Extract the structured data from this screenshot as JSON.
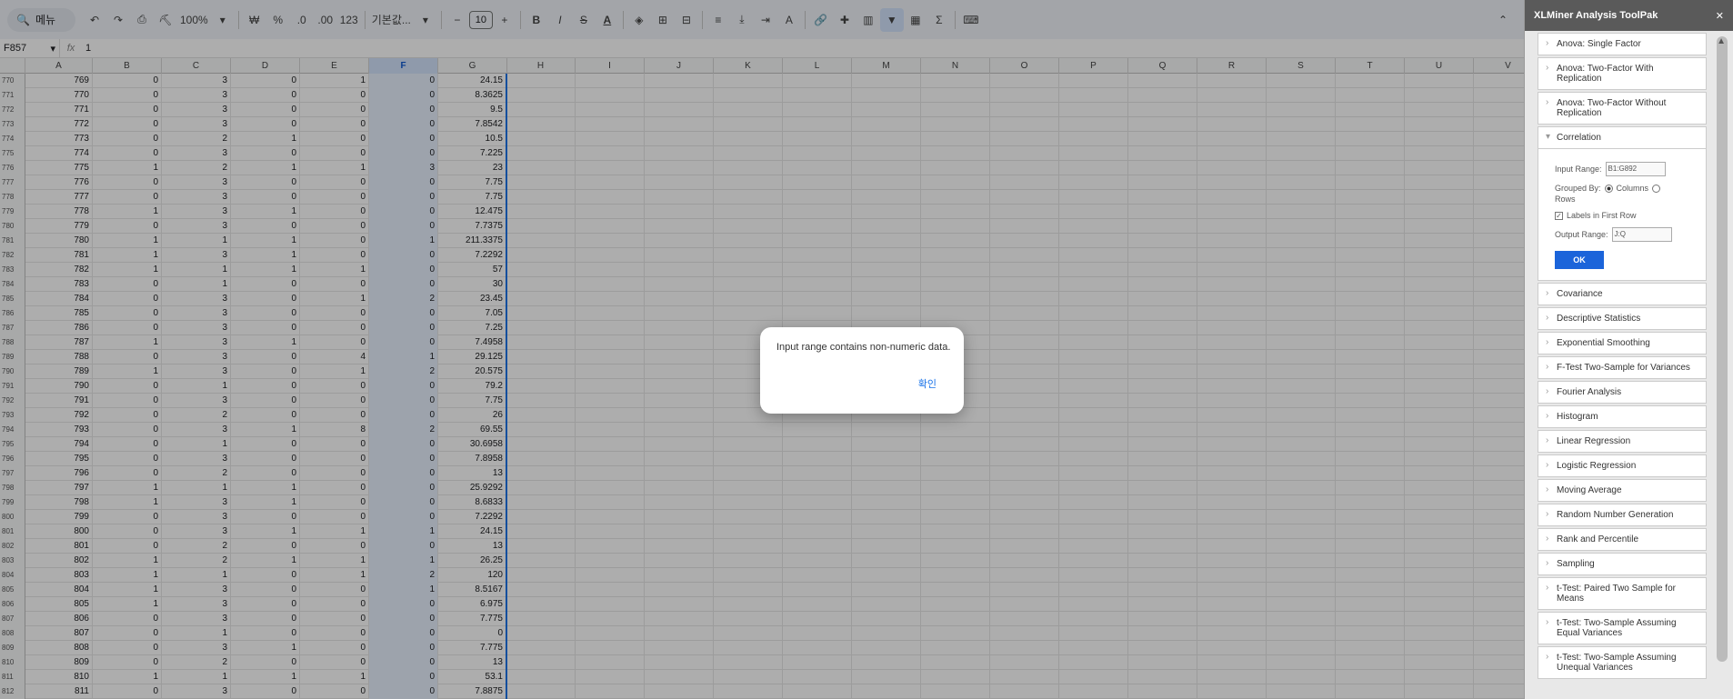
{
  "toolbar": {
    "menu_label": "메뉴",
    "zoom": "100%",
    "currency": "₩",
    "percent": "%",
    "dec_less": ".0",
    "dec_more": ".00",
    "format_123": "123",
    "font_name": "기본값...",
    "font_size": "10",
    "minus": "−",
    "plus": "+",
    "bold": "B",
    "italic": "I",
    "strike": "S",
    "text_color": "A",
    "sigma": "Σ"
  },
  "formula_bar": {
    "cell_ref": "F857",
    "fx": "fx",
    "value": "1"
  },
  "columns": [
    "A",
    "B",
    "C",
    "D",
    "E",
    "F",
    "G",
    "H",
    "I",
    "J",
    "K",
    "L",
    "M",
    "N",
    "O",
    "P",
    "Q",
    "R",
    "S",
    "T",
    "U",
    "V"
  ],
  "rows": [
    [
      "770",
      "769",
      "0",
      "3",
      "0",
      "1",
      "0",
      "24.15"
    ],
    [
      "771",
      "770",
      "0",
      "3",
      "0",
      "0",
      "0",
      "8.3625"
    ],
    [
      "772",
      "771",
      "0",
      "3",
      "0",
      "0",
      "0",
      "9.5"
    ],
    [
      "773",
      "772",
      "0",
      "3",
      "0",
      "0",
      "0",
      "7.8542"
    ],
    [
      "774",
      "773",
      "0",
      "2",
      "1",
      "0",
      "0",
      "10.5"
    ],
    [
      "775",
      "774",
      "0",
      "3",
      "0",
      "0",
      "0",
      "7.225"
    ],
    [
      "776",
      "775",
      "1",
      "2",
      "1",
      "1",
      "3",
      "23"
    ],
    [
      "777",
      "776",
      "0",
      "3",
      "0",
      "0",
      "0",
      "7.75"
    ],
    [
      "778",
      "777",
      "0",
      "3",
      "0",
      "0",
      "0",
      "7.75"
    ],
    [
      "779",
      "778",
      "1",
      "3",
      "1",
      "0",
      "0",
      "12.475"
    ],
    [
      "780",
      "779",
      "0",
      "3",
      "0",
      "0",
      "0",
      "7.7375"
    ],
    [
      "781",
      "780",
      "1",
      "1",
      "1",
      "0",
      "1",
      "211.3375"
    ],
    [
      "782",
      "781",
      "1",
      "3",
      "1",
      "0",
      "0",
      "7.2292"
    ],
    [
      "783",
      "782",
      "1",
      "1",
      "1",
      "1",
      "0",
      "57"
    ],
    [
      "784",
      "783",
      "0",
      "1",
      "0",
      "0",
      "0",
      "30"
    ],
    [
      "785",
      "784",
      "0",
      "3",
      "0",
      "1",
      "2",
      "23.45"
    ],
    [
      "786",
      "785",
      "0",
      "3",
      "0",
      "0",
      "0",
      "7.05"
    ],
    [
      "787",
      "786",
      "0",
      "3",
      "0",
      "0",
      "0",
      "7.25"
    ],
    [
      "788",
      "787",
      "1",
      "3",
      "1",
      "0",
      "0",
      "7.4958"
    ],
    [
      "789",
      "788",
      "0",
      "3",
      "0",
      "4",
      "1",
      "29.125"
    ],
    [
      "790",
      "789",
      "1",
      "3",
      "0",
      "1",
      "2",
      "20.575"
    ],
    [
      "791",
      "790",
      "0",
      "1",
      "0",
      "0",
      "0",
      "79.2"
    ],
    [
      "792",
      "791",
      "0",
      "3",
      "0",
      "0",
      "0",
      "7.75"
    ],
    [
      "793",
      "792",
      "0",
      "2",
      "0",
      "0",
      "0",
      "26"
    ],
    [
      "794",
      "793",
      "0",
      "3",
      "1",
      "8",
      "2",
      "69.55"
    ],
    [
      "795",
      "794",
      "0",
      "1",
      "0",
      "0",
      "0",
      "30.6958"
    ],
    [
      "796",
      "795",
      "0",
      "3",
      "0",
      "0",
      "0",
      "7.8958"
    ],
    [
      "797",
      "796",
      "0",
      "2",
      "0",
      "0",
      "0",
      "13"
    ],
    [
      "798",
      "797",
      "1",
      "1",
      "1",
      "0",
      "0",
      "25.9292"
    ],
    [
      "799",
      "798",
      "1",
      "3",
      "1",
      "0",
      "0",
      "8.6833"
    ],
    [
      "800",
      "799",
      "0",
      "3",
      "0",
      "0",
      "0",
      "7.2292"
    ],
    [
      "801",
      "800",
      "0",
      "3",
      "1",
      "1",
      "1",
      "24.15"
    ],
    [
      "802",
      "801",
      "0",
      "2",
      "0",
      "0",
      "0",
      "13"
    ],
    [
      "803",
      "802",
      "1",
      "2",
      "1",
      "1",
      "1",
      "26.25"
    ],
    [
      "804",
      "803",
      "1",
      "1",
      "0",
      "1",
      "2",
      "120"
    ],
    [
      "805",
      "804",
      "1",
      "3",
      "0",
      "0",
      "1",
      "8.5167"
    ],
    [
      "806",
      "805",
      "1",
      "3",
      "0",
      "0",
      "0",
      "6.975"
    ],
    [
      "807",
      "806",
      "0",
      "3",
      "0",
      "0",
      "0",
      "7.775"
    ],
    [
      "808",
      "807",
      "0",
      "1",
      "0",
      "0",
      "0",
      "0"
    ],
    [
      "809",
      "808",
      "0",
      "3",
      "1",
      "0",
      "0",
      "7.775"
    ],
    [
      "810",
      "809",
      "0",
      "2",
      "0",
      "0",
      "0",
      "13"
    ],
    [
      "811",
      "810",
      "1",
      "1",
      "1",
      "1",
      "0",
      "53.1"
    ],
    [
      "812",
      "811",
      "0",
      "3",
      "0",
      "0",
      "0",
      "7.8875"
    ]
  ],
  "dialog": {
    "message": "Input range contains non-numeric data.",
    "ok": "확인"
  },
  "panel": {
    "title": "XLMiner Analysis ToolPak",
    "close": "✕",
    "tools": [
      "Anova: Single Factor",
      "Anova: Two-Factor With Replication",
      "Anova: Two-Factor Without Replication",
      "Correlation",
      "Covariance",
      "Descriptive Statistics",
      "Exponential Smoothing",
      "F-Test Two-Sample for Variances",
      "Fourier Analysis",
      "Histogram",
      "Linear Regression",
      "Logistic Regression",
      "Moving Average",
      "Random Number Generation",
      "Rank and Percentile",
      "Sampling",
      "t-Test: Paired Two Sample for Means",
      "t-Test: Two-Sample Assuming Equal Variances",
      "t-Test: Two-Sample Assuming Unequal Variances"
    ],
    "correlation": {
      "input_label": "Input Range:",
      "input_value": "B1:G892",
      "grouped_label": "Grouped By:",
      "columns": "Columns",
      "rows": "Rows",
      "labels_first_row": "Labels in First Row",
      "output_label": "Output Range:",
      "output_value": "J:Q",
      "ok": "OK"
    }
  }
}
